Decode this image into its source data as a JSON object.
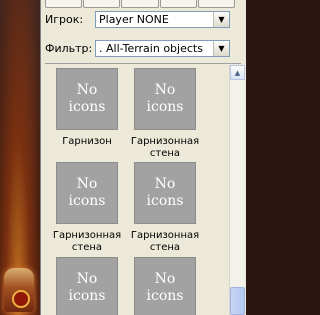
{
  "toolbar": {
    "player_label": "Игрок:",
    "player_value": "Player NONE",
    "filter_label": "Фильтр:",
    "filter_value": ". All-Terrain  objects"
  },
  "thumbnail_placeholder": [
    "No",
    "icons"
  ],
  "objects": [
    {
      "caption": "Гарнизон"
    },
    {
      "caption": "Гарнизонная стена"
    },
    {
      "caption": "Гарнизонная стена"
    },
    {
      "caption": "Гарнизонная стена"
    },
    {
      "caption": ""
    },
    {
      "caption": ""
    }
  ],
  "colors": {
    "panel": "#ece9d8",
    "thumbnail": "#a2a2a2",
    "scrollbar_thumb": "#b4c8f0"
  }
}
